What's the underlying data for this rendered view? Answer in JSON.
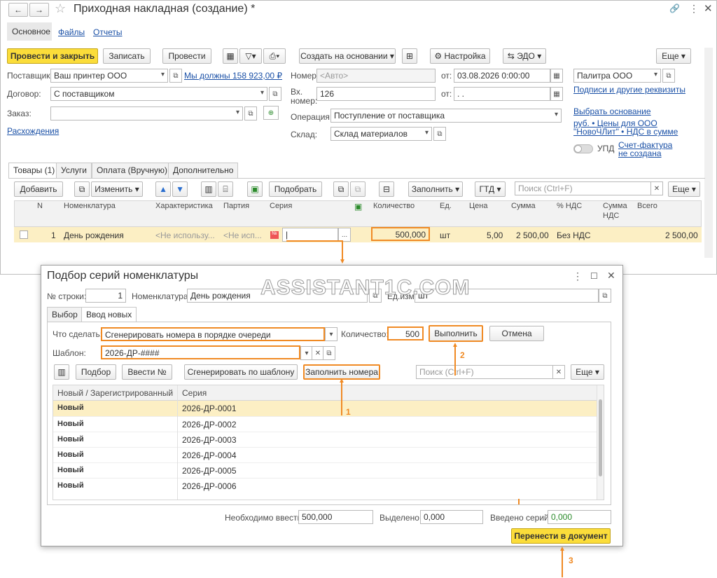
{
  "main": {
    "title": "Приходная накладная (создание) *",
    "nav": {
      "back": "←",
      "forward": "→"
    },
    "top_tabs": [
      "Основное",
      "Файлы",
      "Отчеты"
    ],
    "toolbar": {
      "post_close": "Провести и закрыть",
      "save": "Записать",
      "post": "Провести",
      "create_based": "Создать на основании",
      "settings": "Настройка",
      "edo": "ЭДО",
      "more": "Еще"
    },
    "supplier": {
      "label": "Поставщик:",
      "value": "Ваш принтер ООО",
      "debt_link": "Мы должны 158 923,00 ₽"
    },
    "contract": {
      "label": "Договор:",
      "value": "С поставщиком"
    },
    "order": {
      "label": "Заказ:",
      "value": ""
    },
    "expenses_link": "Расхождения",
    "number": {
      "label": "Номер:",
      "placeholder": "<Авто>",
      "from_label": "от:",
      "date": "03.08.2026  0:00:00"
    },
    "in_number": {
      "label1": "Вх.",
      "label2": "номер:",
      "value": "126",
      "from_label": "от:",
      "date": " .  ."
    },
    "operation": {
      "label": "Операция:",
      "value": "Поступление от поставщика"
    },
    "warehouse": {
      "label": "Склад:",
      "value": "Склад материалов"
    },
    "org": {
      "value": "Палитра ООО",
      "signatures_link": "Подписи и другие реквизиты"
    },
    "basis_link": "Выбрать основание",
    "price_link1": "руб. • Цены для ООО",
    "price_link2": "\"НовоЧЛит\" • НДС в сумме",
    "upd_label": "УПД",
    "invoice_link1": "Счет-фактура",
    "invoice_link2": "не создана",
    "doc_tabs": [
      "Товары (1)",
      "Услуги",
      "Оплата (Вручную)",
      "Дополнительно"
    ],
    "grid_toolbar": {
      "add": "Добавить",
      "change": "Изменить",
      "pick": "Подобрать",
      "fill": "Заполнить",
      "gtd": "ГТД",
      "search_placeholder": "Поиск (Ctrl+F)",
      "more": "Еще"
    },
    "columns": [
      "N",
      "Номенклатура",
      "Характеристика",
      "Партия",
      "Серия",
      "Количество",
      "Ед.",
      "Цена",
      "Сумма",
      "% НДС",
      "Сумма",
      "НДС",
      "Всего"
    ],
    "row": {
      "n": "1",
      "item": "День рождения",
      "characteristic": "<Не использу...",
      "batch": "<Не исп...",
      "series": "|",
      "dots": "...",
      "qty": "500,000",
      "unit": "шт",
      "price": "5,00",
      "sum": "2 500,00",
      "vat": "Без НДС",
      "vat_sum": "",
      "total": "2 500,00"
    }
  },
  "dialog": {
    "title": "Подбор серий номенклатуры",
    "row_label": "№ строки:",
    "row_value": "1",
    "item_label": "Номенклатура:",
    "item_value": "День рождения",
    "unit_label": "Ед.изм.:",
    "unit_value": "шт",
    "tabs": [
      "Выбор",
      "Ввод новых"
    ],
    "action_label": "Что сделать:",
    "action_value": "Сгенерировать номера в порядке очереди",
    "qty_label": "Количество:",
    "qty_value": "500",
    "execute": "Выполнить",
    "cancel": "Отмена",
    "template_label": "Шаблон:",
    "template_value": "2026-ДР-####",
    "buttons": {
      "pick": "Подбор",
      "enter": "Ввести №",
      "generate": "Сгенерировать по шаблону",
      "fill_numbers": "Заполнить номера",
      "search_placeholder": "Поиск (Ctrl+F)",
      "more": "Еще"
    },
    "columns": [
      "Новый / Зарегистрированный",
      "Серия"
    ],
    "rows": [
      {
        "status": "Новый",
        "series": "2026-ДР-0001"
      },
      {
        "status": "Новый",
        "series": "2026-ДР-0002"
      },
      {
        "status": "Новый",
        "series": "2026-ДР-0003"
      },
      {
        "status": "Новый",
        "series": "2026-ДР-0004"
      },
      {
        "status": "Новый",
        "series": "2026-ДР-0005"
      },
      {
        "status": "Новый",
        "series": "2026-ДР-0006"
      }
    ],
    "need_label": "Необходимо ввести:",
    "need_value": "500,000",
    "selected_label": "Выделено:",
    "selected_value": "0,000",
    "entered_label": "Введено серий:",
    "entered_value": "0,000",
    "transfer": "Перенести в документ"
  },
  "annotations": {
    "n1": "1",
    "n2": "2",
    "n3": "3",
    "watermark": "ASSISTANT1C.COM"
  }
}
